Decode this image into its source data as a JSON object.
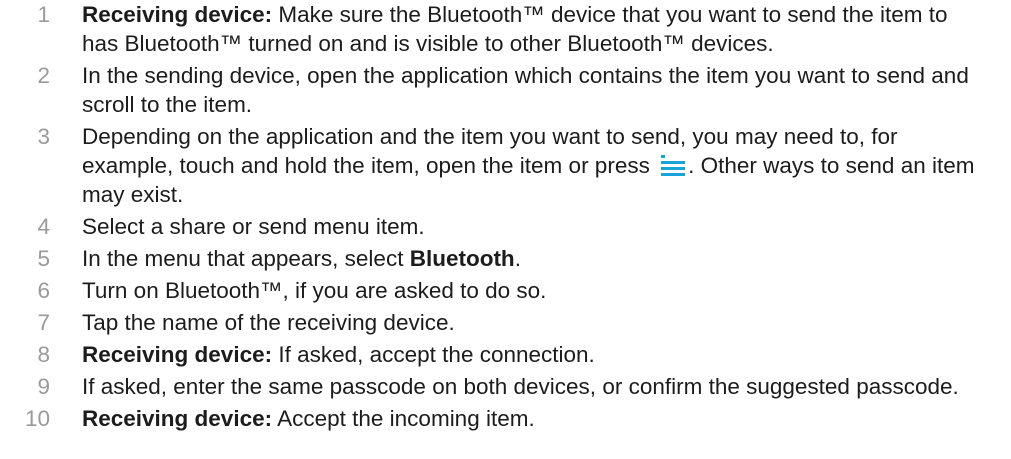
{
  "steps": [
    {
      "number": "1",
      "bold": "Receiving device:",
      "text": " Make sure the Bluetooth™ device that you want to send the item to has Bluetooth™ turned on and is visible to other Bluetooth™ devices."
    },
    {
      "number": "2",
      "text": "In the sending device, open the application which contains the item you want to send and scroll to the item."
    },
    {
      "number": "3",
      "text_before_icon": "Depending on the application and the item you want to send, you may need to, for example, touch and hold the item, open the item or press ",
      "icon": "menu-icon",
      "text_after_icon": ". Other ways to send an item may exist."
    },
    {
      "number": "4",
      "text": "Select a share or send menu item."
    },
    {
      "number": "5",
      "text": "In the menu that appears, select ",
      "bold_end": "Bluetooth",
      "text_end": "."
    },
    {
      "number": "6",
      "text": "Turn on Bluetooth™, if you are asked to do so."
    },
    {
      "number": "7",
      "text": "Tap the name of the receiving device."
    },
    {
      "number": "8",
      "bold": "Receiving device:",
      "text": " If asked, accept the connection."
    },
    {
      "number": "9",
      "text": "If asked, enter the same passcode on both devices, or confirm the suggested passcode."
    },
    {
      "number": "10",
      "bold": "Receiving device:",
      "text": " Accept the incoming item."
    }
  ],
  "colors": {
    "number": "#9a9a9a",
    "text": "#1c1c1c",
    "icon": "#1aa3d9"
  }
}
